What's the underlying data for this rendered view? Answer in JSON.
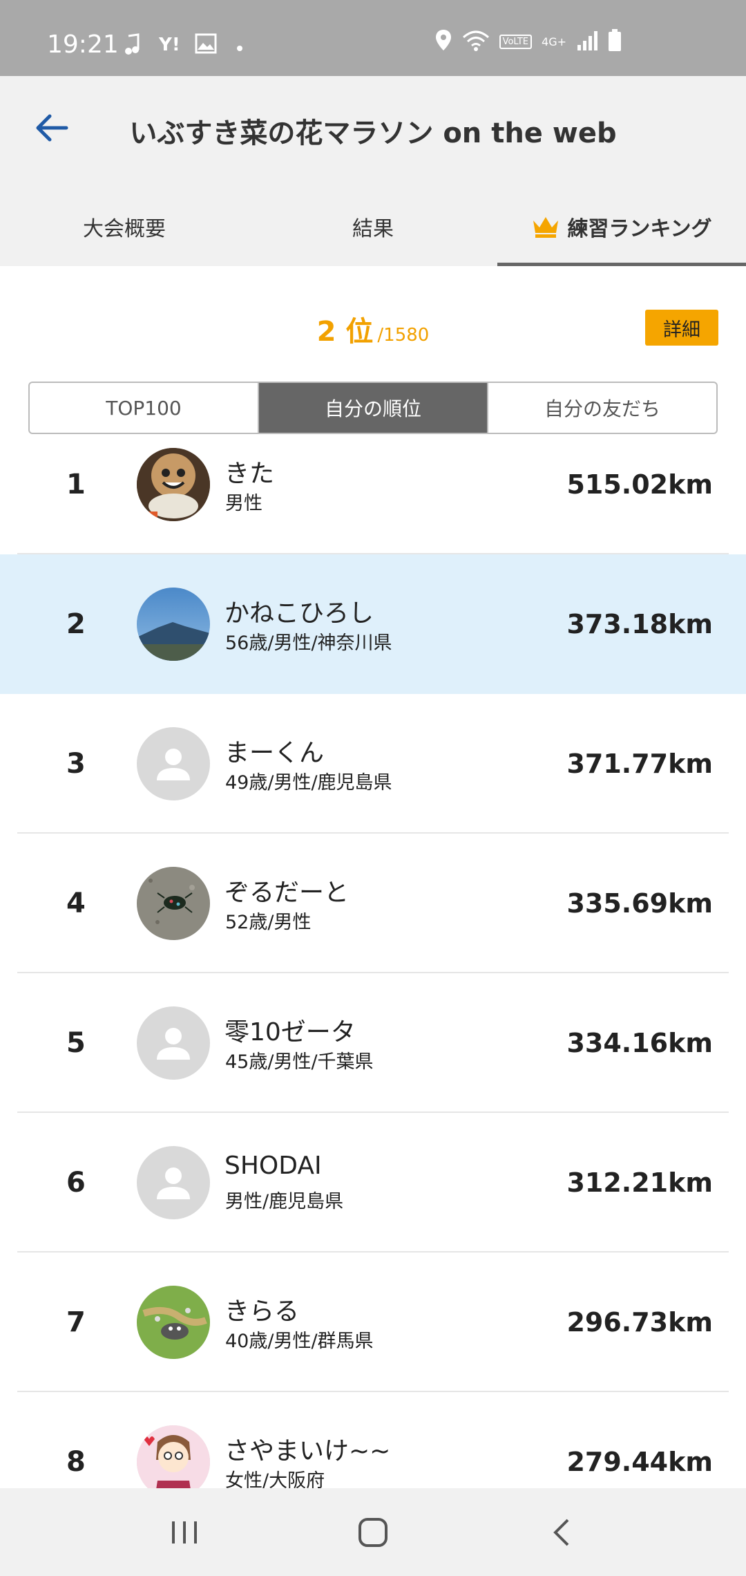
{
  "status": {
    "time": "19:21",
    "net": "4G+"
  },
  "header": {
    "title": "いぶすき菜の花マラソン on the web"
  },
  "tabs": [
    {
      "label": "大会概要"
    },
    {
      "label": "結果"
    },
    {
      "label": "練習ランキング",
      "icon": "crown-icon"
    }
  ],
  "summary": {
    "rank": "2 位",
    "total": "/1580",
    "detail_label": "詳細"
  },
  "segments": [
    {
      "label": "TOP100"
    },
    {
      "label": "自分の順位"
    },
    {
      "label": "自分の友だち"
    }
  ],
  "ranking": [
    {
      "rank": "1",
      "name": "きた",
      "sub": "男性",
      "distance": "515.02km",
      "avatar": "mascot-photo"
    },
    {
      "rank": "2",
      "name": "かねこひろし",
      "sub": "56歳/男性/神奈川県",
      "distance": "373.18km",
      "avatar": "mountain-photo"
    },
    {
      "rank": "3",
      "name": "まーくん",
      "sub": "49歳/男性/鹿児島県",
      "distance": "371.77km",
      "avatar": "default-user-icon"
    },
    {
      "rank": "4",
      "name": "ぞるだーと",
      "sub": "52歳/男性",
      "distance": "335.69km",
      "avatar": "beetle-photo"
    },
    {
      "rank": "5",
      "name": "零10ゼータ",
      "sub": "45歳/男性/千葉県",
      "distance": "334.16km",
      "avatar": "default-user-icon"
    },
    {
      "rank": "6",
      "name": "SHODAI",
      "sub": "男性/鹿児島県",
      "distance": "312.21km",
      "avatar": "default-user-icon"
    },
    {
      "rank": "7",
      "name": "きらる",
      "sub": "40歳/男性/群馬県",
      "distance": "296.73km",
      "avatar": "game-character-photo"
    },
    {
      "rank": "8",
      "name": "さやまいけ~~",
      "sub": "女性/大阪府",
      "distance": "279.44km",
      "avatar": "illustration-avatar"
    }
  ],
  "colors": {
    "accent": "#f5a500",
    "highlight_row": "#dff0fb",
    "back_arrow": "#1f5aa6"
  }
}
